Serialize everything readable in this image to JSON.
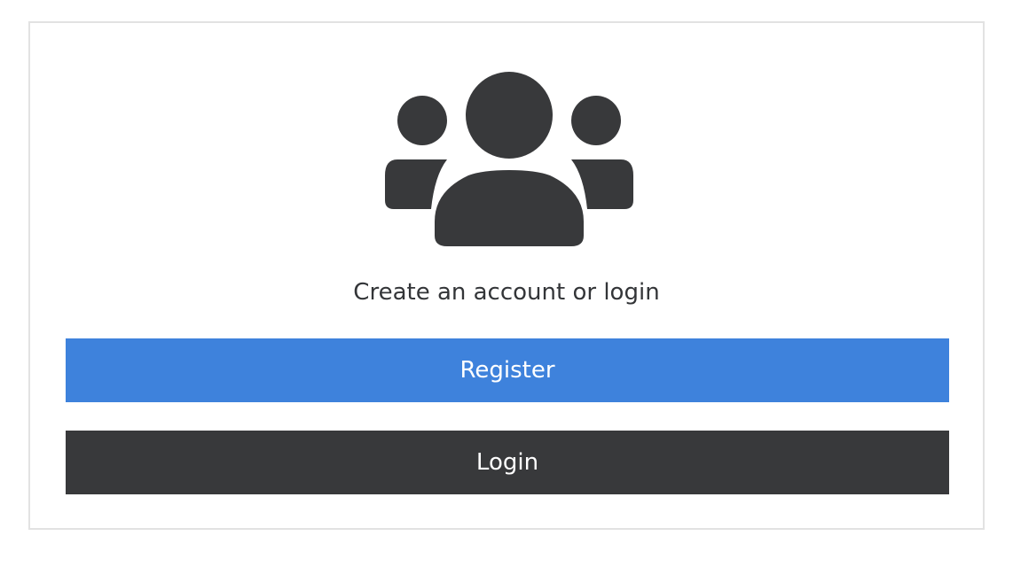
{
  "card": {
    "icon": "users-group-icon",
    "prompt": "Create an account or login"
  },
  "actions": {
    "register_label": "Register",
    "login_label": "Login"
  },
  "colors": {
    "register_bg": "#3e82dc",
    "login_bg": "#38393b",
    "icon": "#38393b",
    "text": "#333538",
    "border": "#e2e2e2"
  }
}
